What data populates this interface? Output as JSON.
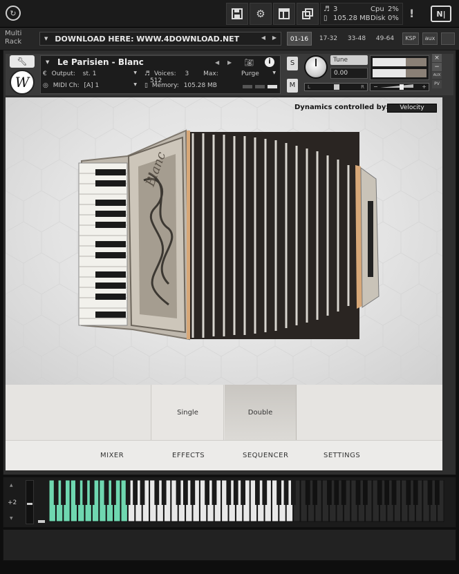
{
  "top_bar": {
    "voices": "3",
    "memory": "105.28 MB",
    "cpu_label": "Cpu",
    "cpu_value": "2%",
    "disk_label": "Disk",
    "disk_value": "0%",
    "alert": "!"
  },
  "rack": {
    "title_line1": "Multi",
    "title_line2": "Rack",
    "preset": "DOWNLOAD HERE: WWW.4DOWNLOAD.NET",
    "tabs": [
      "01-16",
      "17-32",
      "33-48",
      "49-64"
    ],
    "ksp": "KSP",
    "aux": "aux"
  },
  "instrument": {
    "name": "Le Parisien - Blanc",
    "output_label": "Output:",
    "output_value": "st. 1",
    "voices_label": "Voices:",
    "voices_value": "3",
    "max_label": "Max:",
    "max_value": "512",
    "purge": "Purge",
    "midi_label": "MIDI Ch:",
    "midi_value": "[A]  1",
    "memory_label": "Memory:",
    "memory_value": "105.28 MB",
    "solo": "S",
    "mute": "M",
    "tune_label": "Tune",
    "tune_value": "0.00",
    "pan_l": "L",
    "pan_r": "R",
    "aux_label": "AUX",
    "pv_label": "PV",
    "logo_letter": "W"
  },
  "main": {
    "dynamics_label": "Dynamics controlled by:",
    "dynamics_value": "Velocity",
    "accordion_brand": "Blanc",
    "mode_buttons": [
      "Single",
      "Double"
    ],
    "active_mode": "Double",
    "nav": [
      "MIXER",
      "EFFECTS",
      "SEQUENCER",
      "SETTINGS"
    ]
  },
  "keyboard": {
    "octave": "+2",
    "highlight_color": "#6fd7b0"
  }
}
